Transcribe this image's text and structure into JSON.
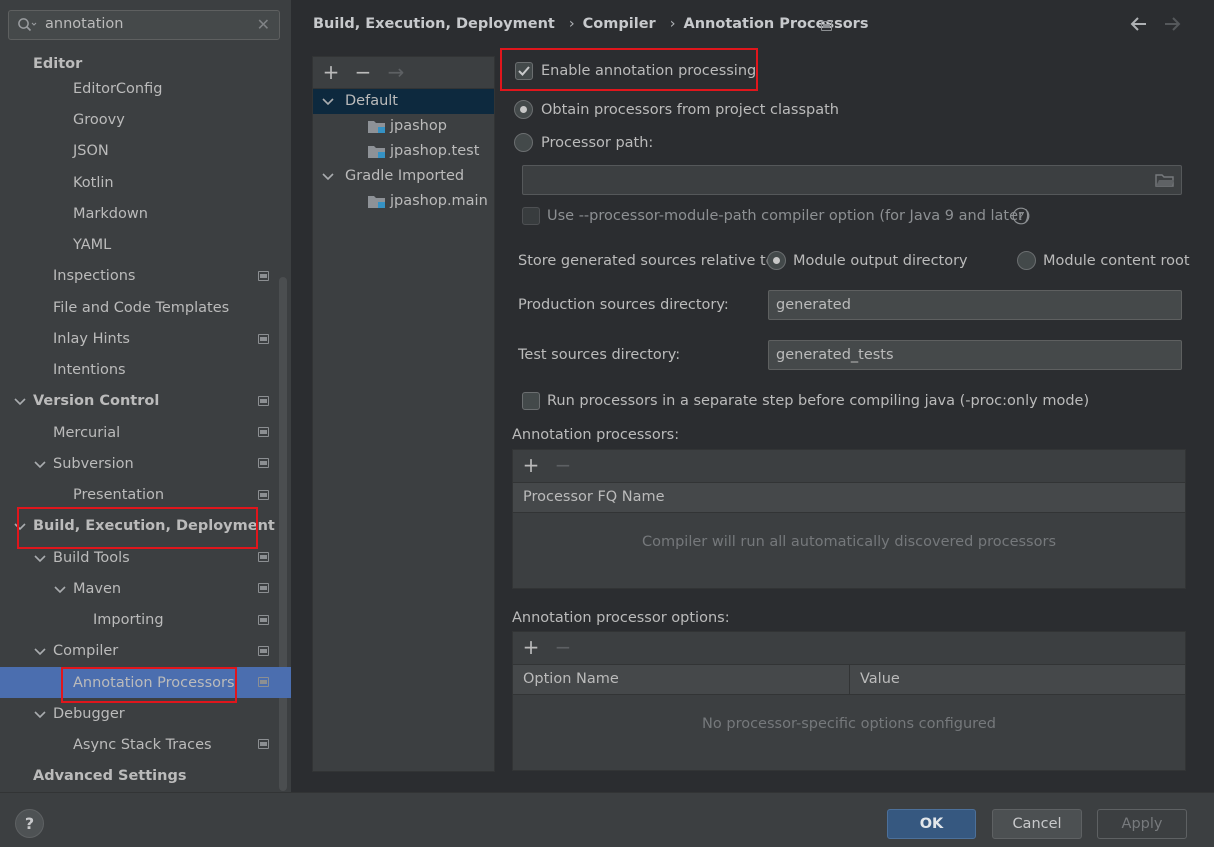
{
  "search": {
    "value": "annotation"
  },
  "sidebar": {
    "items": [
      {
        "label": "Editor",
        "bold": true
      },
      {
        "label": "EditorConfig"
      },
      {
        "label": "Groovy"
      },
      {
        "label": "JSON"
      },
      {
        "label": "Kotlin"
      },
      {
        "label": "Markdown"
      },
      {
        "label": "YAML"
      },
      {
        "label": "Inspections"
      },
      {
        "label": "File and Code Templates"
      },
      {
        "label": "Inlay Hints"
      },
      {
        "label": "Intentions"
      },
      {
        "label": "Version Control",
        "bold": true,
        "expanded": true
      },
      {
        "label": "Mercurial"
      },
      {
        "label": "Subversion",
        "expanded": true
      },
      {
        "label": "Presentation"
      },
      {
        "label": "Build, Execution, Deployment",
        "bold": true,
        "expanded": true,
        "highlighted": true
      },
      {
        "label": "Build Tools",
        "expanded": true
      },
      {
        "label": "Maven",
        "expanded": true
      },
      {
        "label": "Importing"
      },
      {
        "label": "Compiler",
        "expanded": true
      },
      {
        "label": "Annotation Processors",
        "selected": true,
        "highlighted": true
      },
      {
        "label": "Debugger",
        "expanded": true
      },
      {
        "label": "Async Stack Traces"
      },
      {
        "label": "Advanced Settings",
        "bold": true
      }
    ]
  },
  "breadcrumb": [
    "Build, Execution, Deployment",
    "Compiler",
    "Annotation Processors"
  ],
  "modules": {
    "toolbar": {
      "add": "+",
      "remove": "−",
      "move": "→"
    },
    "items": [
      {
        "label": "Default",
        "group": true,
        "selected": true
      },
      {
        "label": "jpashop"
      },
      {
        "label": "jpashop.test"
      },
      {
        "label": "Gradle Imported",
        "group": true
      },
      {
        "label": "jpashop.main"
      }
    ]
  },
  "settings": {
    "enable_label": "Enable annotation processing",
    "enable_checked": true,
    "obtain_label": "Obtain processors from project classpath",
    "processor_path_label": "Processor path:",
    "processor_path_value": "",
    "module_path_label": "Use --processor-module-path compiler option (for Java 9 and later)",
    "store_label": "Store generated sources relative to:",
    "store_module_output": "Module output directory",
    "store_module_content": "Module content root",
    "production_label": "Production sources directory:",
    "production_value": "generated",
    "test_label": "Test sources directory:",
    "test_value": "generated_tests",
    "run_separate_label": "Run processors in a separate step before compiling java (-proc:only mode)"
  },
  "processors_table": {
    "title": "Annotation processors:",
    "column": "Processor FQ Name",
    "empty_text": "Compiler will run all automatically discovered processors"
  },
  "options_table": {
    "title": "Annotation processor options:",
    "columns": [
      "Option Name",
      "Value"
    ],
    "empty_text": "No processor-specific options configured"
  },
  "footer": {
    "help": "?",
    "ok": "OK",
    "cancel": "Cancel",
    "apply": "Apply"
  },
  "colors": {
    "selection": "#4b6eaf",
    "highlight_box": "#e0161c",
    "background": "#2b2d30",
    "panel": "#3c3f41"
  }
}
